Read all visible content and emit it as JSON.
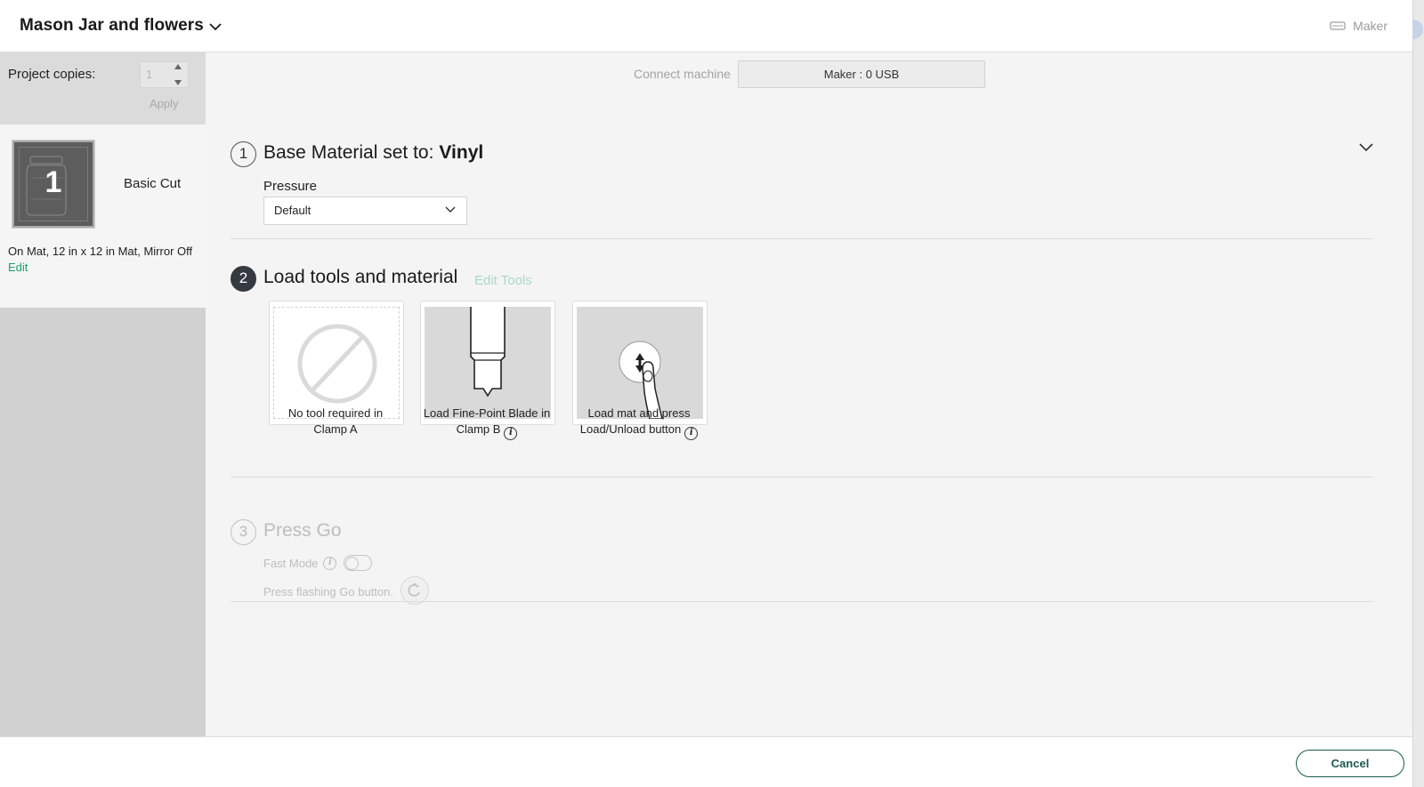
{
  "header": {
    "project_title": "Mason Jar and flowers",
    "machine_name": "Maker"
  },
  "sidebar": {
    "copies_label": "Project copies:",
    "copies_value": "1",
    "apply_label": "Apply",
    "mat": {
      "number": "1",
      "mode": "Basic Cut",
      "info": "On Mat, 12 in x 12 in Mat, Mirror Off",
      "edit_label": "Edit"
    }
  },
  "connect": {
    "label": "Connect machine",
    "button_label": "Maker : 0 USB"
  },
  "step1": {
    "number": "1",
    "title": "Base Material set to:",
    "material": "Vinyl",
    "pressure_label": "Pressure",
    "pressure_value": "Default"
  },
  "step2": {
    "number": "2",
    "title": "Load tools and material",
    "edit_tools_label": "Edit Tools",
    "tools": [
      {
        "caption_line1": "No tool required in",
        "caption_line2": "Clamp A"
      },
      {
        "caption_line1": "Load Fine-Point Blade in",
        "caption_line2": "Clamp B"
      },
      {
        "caption_line1": "Load mat and press",
        "caption_line2": "Load/Unload button"
      }
    ]
  },
  "step3": {
    "number": "3",
    "title": "Press Go",
    "fast_mode_label": "Fast Mode",
    "press_go_text": "Press flashing Go button."
  },
  "footer": {
    "cancel_label": "Cancel"
  }
}
